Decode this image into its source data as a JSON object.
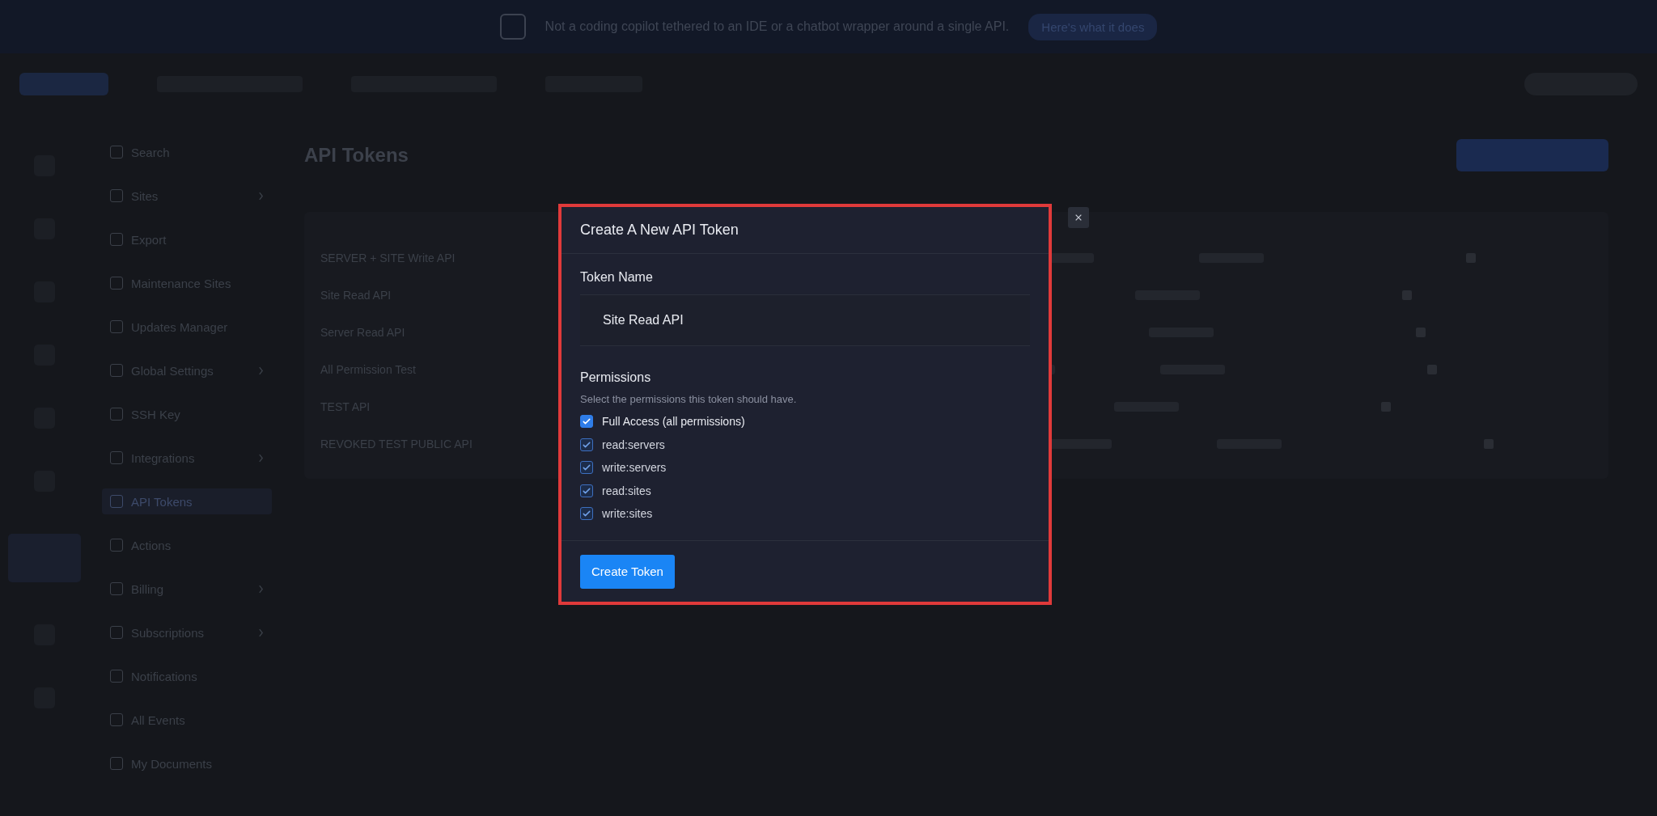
{
  "banner": {
    "text": "Not a coding copilot tethered to an IDE or a chatbot wrapper around a single API.",
    "button": "Here's what it does"
  },
  "page": {
    "title": "API Tokens"
  },
  "nav": {
    "items": [
      {
        "label": "Search",
        "expandable": false,
        "selected": false
      },
      {
        "label": "Sites",
        "expandable": true,
        "selected": false
      },
      {
        "label": "Export",
        "expandable": false,
        "selected": false
      },
      {
        "label": "Maintenance Sites",
        "expandable": false,
        "selected": false
      },
      {
        "label": "Updates Manager",
        "expandable": false,
        "selected": false
      },
      {
        "label": "Global Settings",
        "expandable": true,
        "selected": false
      },
      {
        "label": "SSH Key",
        "expandable": false,
        "selected": false
      },
      {
        "label": "Integrations",
        "expandable": true,
        "selected": false
      },
      {
        "label": "API Tokens",
        "expandable": false,
        "selected": true
      },
      {
        "label": "Actions",
        "expandable": false,
        "selected": false
      },
      {
        "label": "Billing",
        "expandable": true,
        "selected": false
      },
      {
        "label": "Subscriptions",
        "expandable": true,
        "selected": false
      },
      {
        "label": "Notifications",
        "expandable": false,
        "selected": false
      },
      {
        "label": "All Events",
        "expandable": false,
        "selected": false
      },
      {
        "label": "My Documents",
        "expandable": false,
        "selected": false
      }
    ]
  },
  "table": {
    "rows": [
      {
        "name": "SERVER + SITE Write API"
      },
      {
        "name": "Site Read API"
      },
      {
        "name": "Server Read API"
      },
      {
        "name": "All Permission Test"
      },
      {
        "name": "TEST API"
      },
      {
        "name": "REVOKED TEST PUBLIC API"
      }
    ]
  },
  "modal": {
    "title": "Create A New API Token",
    "name_label": "Token Name",
    "name_value": "Site Read API",
    "permissions_label": "Permissions",
    "permissions_hint": "Select the permissions this token should have.",
    "permissions": [
      {
        "label": "Full Access (all permissions)",
        "checked": true,
        "disabled": false
      },
      {
        "label": "read:servers",
        "checked": true,
        "disabled": true
      },
      {
        "label": "write:servers",
        "checked": true,
        "disabled": true
      },
      {
        "label": "read:sites",
        "checked": true,
        "disabled": true
      },
      {
        "label": "write:sites",
        "checked": true,
        "disabled": true
      }
    ],
    "submit": "Create Token"
  }
}
